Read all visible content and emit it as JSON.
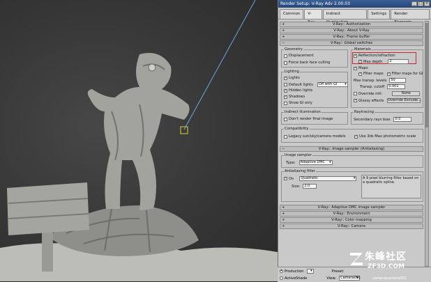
{
  "window": {
    "title": "Render Setup: V-Ray Adv 2.00.03"
  },
  "tabs": [
    "Common",
    "V-Ray",
    "Indirect illumination",
    "Settings",
    "Render Elements"
  ],
  "rollouts_top": [
    "V-Ray:: Authorization",
    "V-Ray:: About V-Ray",
    "V-Ray:: Frame buffer",
    "V-Ray:: Global switches"
  ],
  "geometry": {
    "title": "Geometry",
    "displacement": "Displacement",
    "force_back": "Force back face culling"
  },
  "materials": {
    "title": "Materials",
    "reflection": "Reflection/refraction",
    "max_depth_label": "Max depth",
    "max_depth_value": "2",
    "maps": "Maps",
    "filter_maps": "Filter maps",
    "filter_maps_gi": "Filter maps for GI",
    "max_transp_label": "Max transp. levels",
    "max_transp_value": "50",
    "transp_cutoff_label": "Transp. cutoff",
    "transp_cutoff_value": "0.001",
    "override_mtl": "Override mtl:",
    "override_mtl_btn": "None",
    "glossy": "Glossy effects",
    "glossy_btn": "Override Exclude..."
  },
  "lighting": {
    "title": "Lighting",
    "lights": "Lights",
    "default_lights": "Default lights",
    "default_lights_value": "Off with GI",
    "hidden_lights": "Hidden lights",
    "shadows": "Shadows",
    "show_gi": "Show GI only"
  },
  "indirect": {
    "title": "Indirect illumination",
    "dont_render": "Don't render final image"
  },
  "raytracing": {
    "title": "Raytracing",
    "bias_label": "Secondary rays bias",
    "bias_value": "0.0"
  },
  "compat": {
    "title": "Compatibility",
    "legacy": "Legacy sun/sky/camera models",
    "use3ds": "Use 3ds Max photometric scale"
  },
  "image_sampler_rollout": "V-Ray:: Image sampler (Antialiasing)",
  "image_sampler": {
    "title": "Image sampler",
    "type_label": "Type:",
    "type_value": "Adaptive DMC"
  },
  "aa_filter": {
    "title": "Antialiasing filter",
    "on": "On",
    "filter_value": "Quadratic",
    "desc": "A 9 pixel blurring filter based on a quadratic spline.",
    "size_label": "Size:",
    "size_value": "2.0"
  },
  "rollouts_bottom": [
    "V-Ray:: Adaptive DMC image sampler",
    "V-Ray:: Environment",
    "V-Ray:: Color mapping",
    "V-Ray:: Camera"
  ],
  "bottom": {
    "mode": "Production",
    "preset_label": "Preset:",
    "active_shade": "ActiveShade",
    "view_label": "View:",
    "view_value": "Camera001",
    "extra_text": "cameracamera001"
  },
  "watermark": {
    "cn": "朱峰社区",
    "url": "ZF3D.COM"
  },
  "colors": {
    "highlight_box": "#c8242b",
    "panel": "#c9c9c9",
    "titlebar": "#2f5189"
  }
}
